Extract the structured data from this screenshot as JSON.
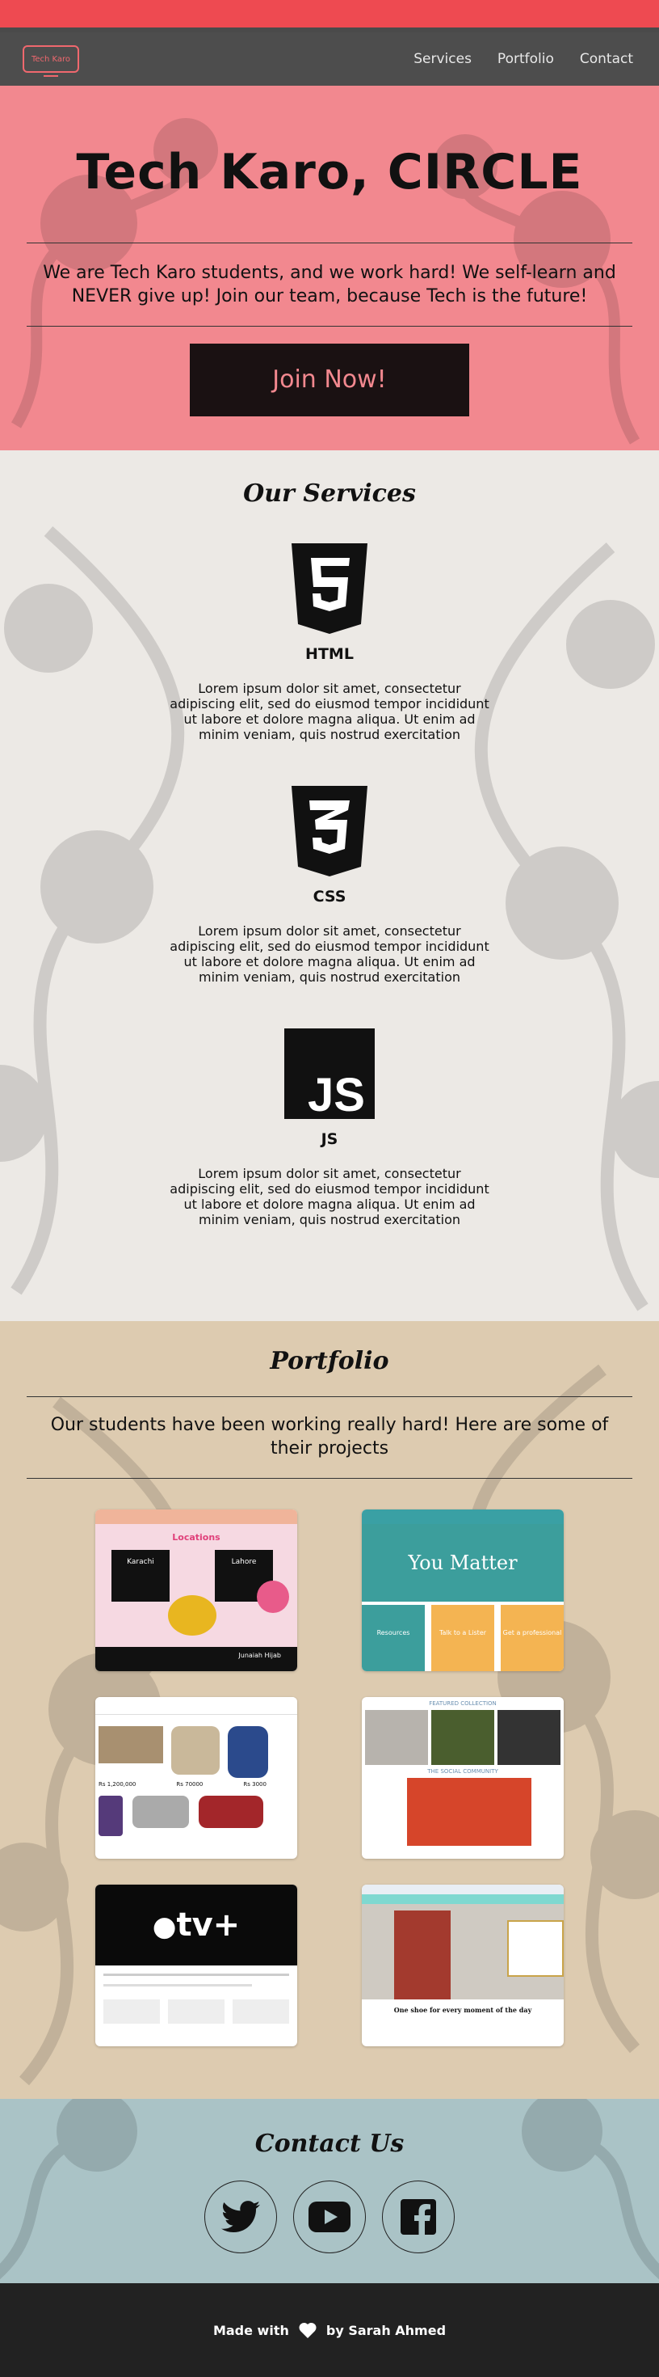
{
  "nav": {
    "logo_text": "Tech Karo",
    "links": [
      "Services",
      "Portfolio",
      "Contact"
    ]
  },
  "hero": {
    "title": "Tech Karo, CIRCLE",
    "tagline": "We are Tech Karo students, and we work hard! We self-learn and NEVER give up! Join our team, because Tech is the future!",
    "cta": "Join Now!"
  },
  "services": {
    "title": "Our Services",
    "items": [
      {
        "name": "HTML",
        "icon": "html5-icon",
        "text": "Lorem ipsum dolor sit amet, consectetur adipiscing elit, sed do eiusmod tempor incididunt ut labore et dolore magna aliqua. Ut enim ad minim veniam, quis nostrud exercitation"
      },
      {
        "name": "CSS",
        "icon": "css3-icon",
        "text": "Lorem ipsum dolor sit amet, consectetur adipiscing elit, sed do eiusmod tempor incididunt ut labore et dolore magna aliqua. Ut enim ad minim veniam, quis nostrud exercitation"
      },
      {
        "name": "JS",
        "icon": "js-icon",
        "text": "Lorem ipsum dolor sit amet, consectetur adipiscing elit, sed do eiusmod tempor incididunt ut labore et dolore magna aliqua. Ut enim ad minim veniam, quis nostrud exercitation"
      }
    ]
  },
  "portfolio": {
    "title": "Portfolio",
    "lead": "Our students have been working really hard! Here are some of their projects",
    "projects": [
      {
        "thumb": "locations-site",
        "headline": "Locations",
        "cities": [
          "Karachi",
          "Lahore"
        ],
        "owner": "Junaiah Hijab"
      },
      {
        "thumb": "you-matter-site",
        "headline": "You Matter",
        "buttons": [
          "Resources",
          "Talk to a Lister",
          "Get a professional"
        ]
      },
      {
        "thumb": "classifieds-site",
        "prices": [
          "Rs 1,200,000",
          "Rs 70000",
          "Rs 3000"
        ]
      },
      {
        "thumb": "fashion-site",
        "labels": [
          "FEATURED COLLECTION",
          "THE SOCIAL COMMUNITY"
        ]
      },
      {
        "thumb": "apple-tv-site",
        "headline": "tv+"
      },
      {
        "thumb": "shoes-site",
        "headline": "One shoe for every moment of the day"
      }
    ]
  },
  "contact": {
    "title": "Contact Us",
    "socials": [
      "twitter",
      "youtube",
      "facebook"
    ]
  },
  "footer": {
    "made_with": "Made with",
    "by": "by Sarah Ahmed"
  },
  "colors": {
    "hero_bg": "#f2888f",
    "services_bg": "#ece9e5",
    "portfolio_bg": "#ddcbb0",
    "contact_bg": "#aac3c6",
    "footer_bg": "#222222",
    "accent_red": "#ee4a51"
  }
}
